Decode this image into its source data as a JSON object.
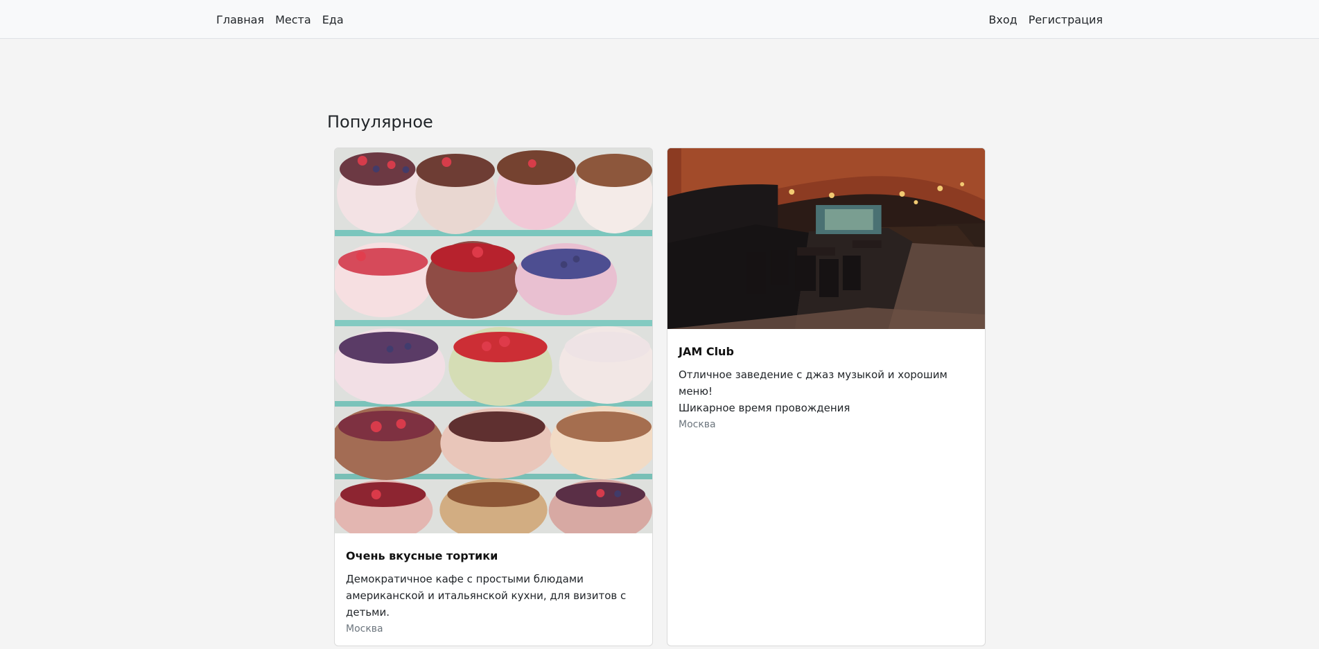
{
  "nav": {
    "left": [
      "Главная",
      "Места",
      "Еда"
    ],
    "right": [
      "Вход",
      "Регистрация"
    ]
  },
  "section": {
    "title": "Популярное"
  },
  "cards": [
    {
      "title": "Очень вкусные тортики",
      "description": "Демократичное кафе с простыми блюдами\nамериканской и итальянской кухни, для визитов с\nдетьми.",
      "city": "Москва",
      "image_icon": "cake-display-photo"
    },
    {
      "title": "JAM Club",
      "description": "Отличное заведение с джаз музыкой и хорошим меню!\nШикарное время провождения",
      "city": "Москва",
      "image_icon": "jazz-club-interior-photo"
    }
  ]
}
